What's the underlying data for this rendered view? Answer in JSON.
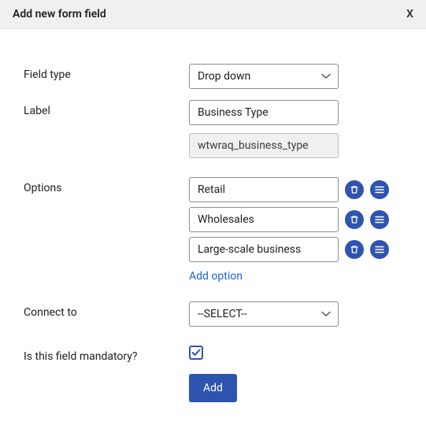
{
  "header": {
    "title": "Add new form field",
    "close": "X"
  },
  "fields": {
    "fieldType": {
      "label": "Field type",
      "value": "Drop down"
    },
    "labelField": {
      "label": "Label",
      "value": "Business Type"
    },
    "slug": {
      "value": "wtwraq_business_type"
    },
    "options": {
      "label": "Options",
      "items": [
        "Retail",
        "Wholesales",
        "Large-scale business"
      ],
      "addLink": "Add option"
    },
    "connectTo": {
      "label": "Connect to",
      "value": "--SELECT--"
    },
    "mandatory": {
      "label": "Is this field mandatory?",
      "checked": true
    },
    "submit": {
      "label": "Add"
    }
  }
}
